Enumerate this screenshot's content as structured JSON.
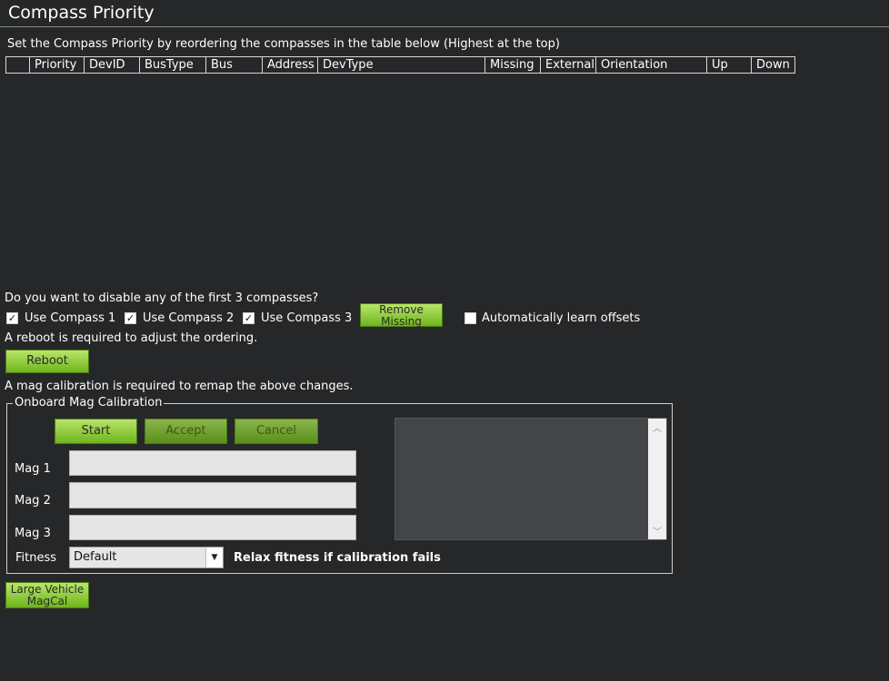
{
  "title": "Compass Priority",
  "instructions": "Set the Compass Priority by reordering the compasses in the table below (Highest at the top)",
  "table": {
    "columns": [
      "Priority",
      "DevID",
      "BusType",
      "Bus",
      "Address",
      "DevType",
      "Missing",
      "External",
      "Orientation",
      "Up",
      "Down"
    ]
  },
  "disable_question": "Do you want to disable any of the first 3 compasses?",
  "checkboxes": {
    "use_compass_1": {
      "label": "Use Compass 1",
      "checked": true
    },
    "use_compass_2": {
      "label": "Use Compass 2",
      "checked": true
    },
    "use_compass_3": {
      "label": "Use Compass 3",
      "checked": true
    },
    "auto_learn": {
      "label": "Automatically learn offsets",
      "checked": false
    }
  },
  "remove_missing_label": "Remove Missing",
  "reboot_note": "A reboot is required to adjust the ordering.",
  "reboot_label": "Reboot",
  "magcal_note": "A mag calibration is required to remap the above changes.",
  "onboard": {
    "legend": "Onboard Mag Calibration",
    "start": "Start",
    "accept": "Accept",
    "cancel": "Cancel",
    "mag1": "Mag 1",
    "mag2": "Mag 2",
    "mag3": "Mag 3",
    "fitness_label": "Fitness",
    "fitness_value": "Default",
    "relax": "Relax fitness if calibration fails"
  },
  "large_vehicle_label": "Large Vehicle MagCal",
  "icons": {
    "check": "checkmark-icon",
    "dropdown": "chevron-down-icon",
    "scroll_up": "chevron-up-icon",
    "scroll_down": "chevron-down-icon"
  }
}
